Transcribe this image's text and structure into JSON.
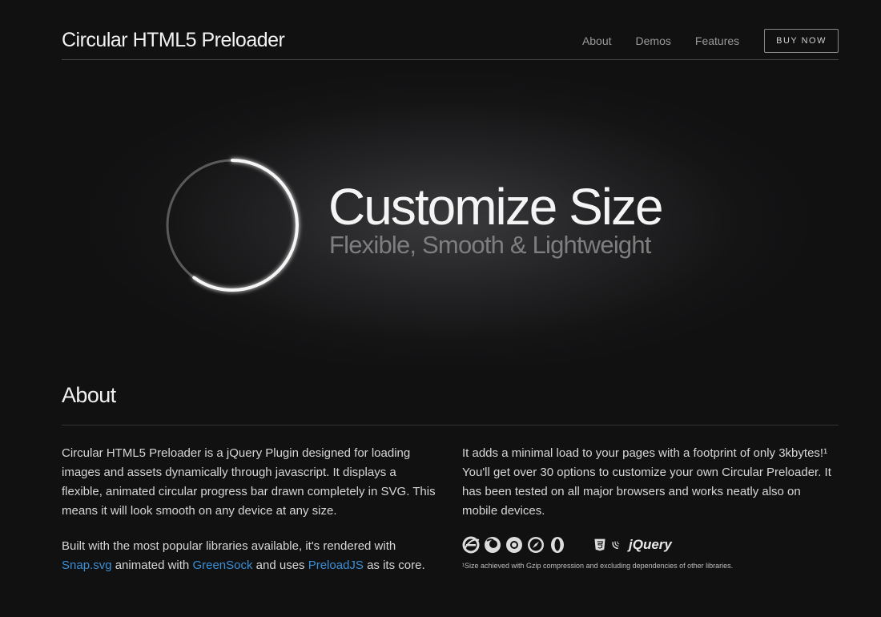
{
  "header": {
    "title": "Circular HTML5 Preloader",
    "nav": [
      "About",
      "Demos",
      "Features"
    ],
    "buy_label": "BUY NOW"
  },
  "hero": {
    "title": "Customize Size",
    "subtitle": "Flexible, Smooth & Lightweight",
    "progress_percent": 60
  },
  "about": {
    "title": "About",
    "left": {
      "p1": "Circular HTML5 Preloader is a jQuery Plugin designed for loading images and assets dynamically through javascript. It displays a flexible, animated circular progress bar drawn completely in SVG. This means it will look smooth on any device at any size.",
      "p2_start": "Built with the most popular libraries available, it's rendered with",
      "link1": "Snap.svg",
      "p2_mid1": " animated with ",
      "link2": "GreenSock",
      "p2_mid2": " and uses ",
      "link3": "PreloadJS",
      "p2_end": " as its core."
    },
    "right": {
      "p1": "It adds a minimal load to your pages with a footprint of only 3kbytes!¹ You'll get over 30 options to customize your own Circular Preloader. It has been tested on all major browsers and works neatly also on mobile devices.",
      "jquery_label": "jQuery",
      "footnote": "¹Size achieved with Gzip compression and excluding dependencies of other libraries."
    }
  },
  "icons": [
    "ie-icon",
    "firefox-icon",
    "chrome-icon",
    "safari-icon",
    "opera-icon",
    "html5-icon",
    "jquery-icon"
  ],
  "colors": {
    "link": "#3a8fd6",
    "background": "#111112"
  }
}
